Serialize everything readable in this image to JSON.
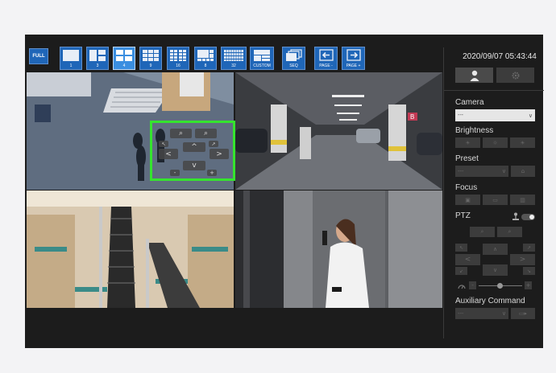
{
  "toolbar": {
    "full_label": "FULL",
    "buttons": [
      {
        "label": "1"
      },
      {
        "label": "3"
      },
      {
        "label": "4"
      },
      {
        "label": "9"
      },
      {
        "label": "16"
      },
      {
        "label": "8"
      },
      {
        "label": "32"
      },
      {
        "label": "CUSTOM"
      },
      {
        "label": "SEQ"
      },
      {
        "label": "PAGE -"
      },
      {
        "label": "PAGE +"
      }
    ],
    "active": "4"
  },
  "cameras": [
    {
      "id": "cam-1",
      "scene": "office lobby stairs"
    },
    {
      "id": "cam-2",
      "scene": "parking garage",
      "sign": "B"
    },
    {
      "id": "cam-3",
      "scene": "mall escalators"
    },
    {
      "id": "cam-4",
      "scene": "woman with phone"
    }
  ],
  "ptz_overlay": {
    "zoom_out": "⌕",
    "zoom_in": "⌕",
    "up": "^",
    "down": "v",
    "left": "<",
    "right": ">",
    "minus": "-",
    "plus": "+"
  },
  "panel": {
    "datetime": "2020/09/07 05:43:44",
    "camera_label": "Camera",
    "camera_value": "---",
    "brightness_label": "Brightness",
    "preset_label": "Preset",
    "preset_value": "---",
    "focus_label": "Focus",
    "ptz_label": "PTZ",
    "aux_label": "Auxiliary Command",
    "aux_value": "---",
    "colors": {
      "accent": "#1f66b8",
      "overlay": "#35e42e"
    }
  }
}
